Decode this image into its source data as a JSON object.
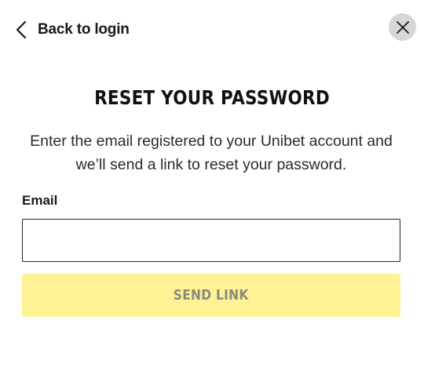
{
  "header": {
    "back_label": "Back to login",
    "back_icon": "chevron-left-icon",
    "close_icon": "close-icon"
  },
  "main": {
    "title": "RESET YOUR PASSWORD",
    "description": "Enter the email registered to your Unibet account and we’ll send a link to reset your password.",
    "email_label": "Email",
    "email_value": "",
    "email_placeholder": "",
    "submit_label": "SEND LINK",
    "submit_disabled": true
  },
  "colors": {
    "background": "#ffffff",
    "close_button_bg": "#d6d6d6",
    "submit_bg_disabled": "#fff294",
    "submit_text_disabled": "#8a8a7a",
    "text_primary": "#1a1a1a"
  }
}
